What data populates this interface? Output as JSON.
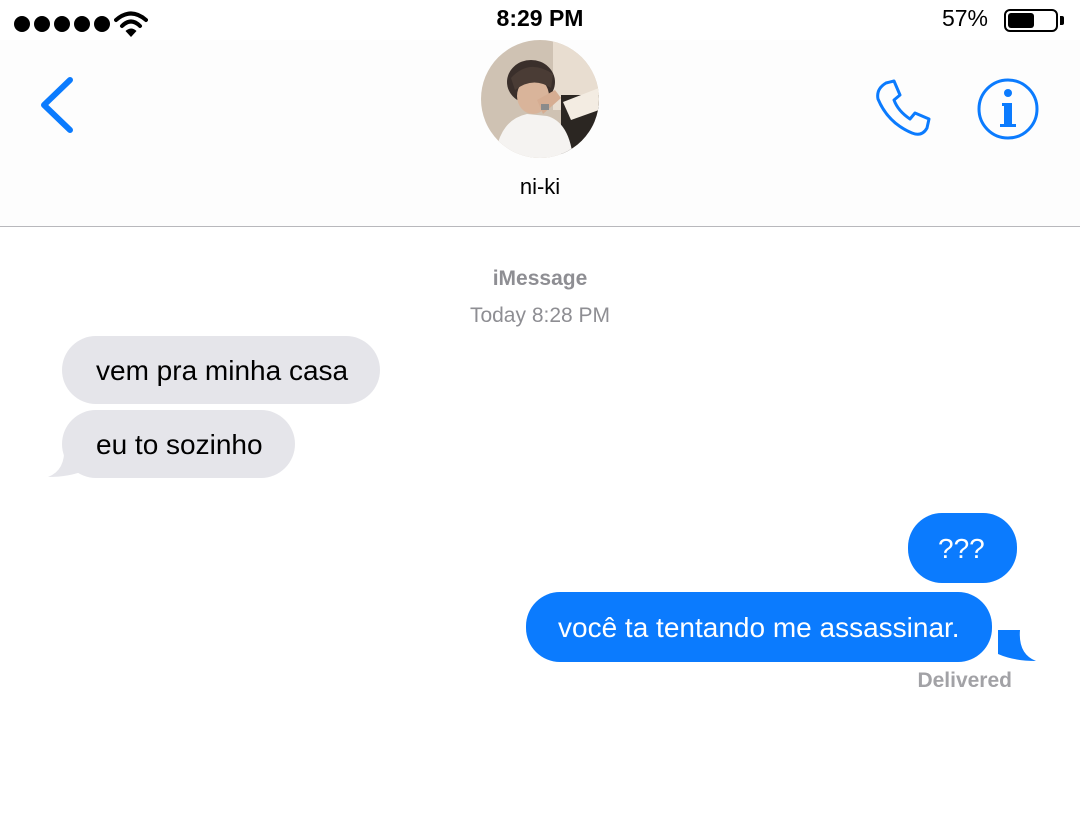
{
  "status_bar": {
    "signal_dots": 5,
    "wifi_icon": "wifi-icon",
    "time": "8:29 PM",
    "battery_percent": "57%",
    "battery_level": 0.57
  },
  "header": {
    "back_icon": "chevron-left-icon",
    "contact_name": "ni-ki",
    "call_icon": "phone-icon",
    "info_icon": "info-icon"
  },
  "thread": {
    "service": "iMessage",
    "timestamp": "Today 8:28 PM",
    "received": [
      {
        "text": "vem pra minha casa"
      },
      {
        "text": "eu to sozinho"
      }
    ],
    "sent": [
      {
        "text": "???"
      },
      {
        "text": "você ta tentando me assassinar."
      }
    ],
    "status": "Delivered"
  },
  "colors": {
    "accent": "#0b7bfe",
    "incoming_bubble": "#e5e5ea",
    "secondary_text": "#8e8e93"
  }
}
